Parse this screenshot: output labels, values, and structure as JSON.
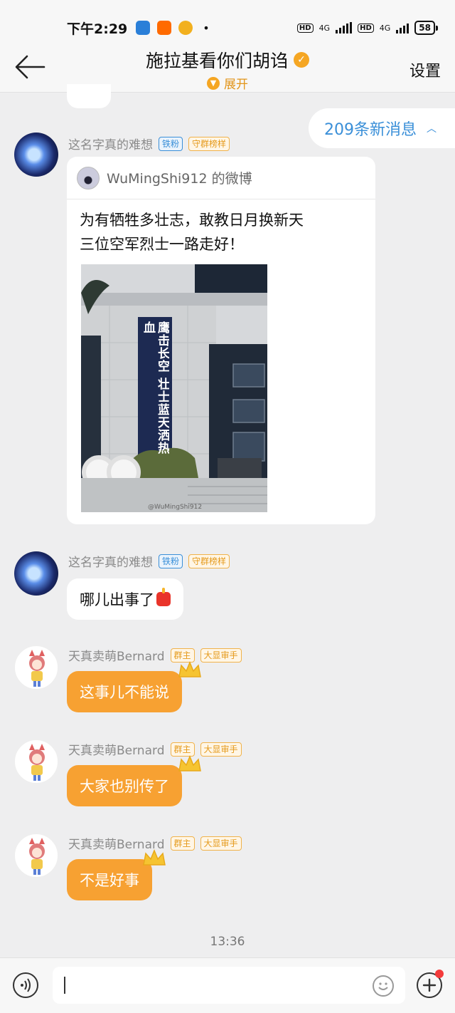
{
  "status_bar": {
    "time": "下午2:29",
    "dot": "•",
    "hd1": "HD",
    "net1": "4G",
    "hd2": "HD",
    "net2": "4G",
    "battery": "58"
  },
  "header": {
    "title": "施拉基看你们胡诌",
    "expand_label": "展开",
    "settings_label": "设置"
  },
  "new_messages": {
    "label": "209条新消息"
  },
  "messages": [
    {
      "sender": "这名字真的难想",
      "badges": [
        "铁粉",
        "守群榜样"
      ],
      "card": {
        "source": "WuMingShi912 的微博",
        "text_line1": "为有牺牲多壮志，敢教日月换新天",
        "text_line2": "三位空军烈士一路走好！",
        "banner_text": "鹰击长空 壮士蓝天洒热血",
        "watermark": "@WuMingShi912"
      }
    },
    {
      "sender": "这名字真的难想",
      "badges": [
        "铁粉",
        "守群榜样"
      ],
      "text": "哪儿出事了"
    },
    {
      "sender": "天真卖萌Bernard",
      "badges": [
        "群主",
        "大显审手"
      ],
      "text": "这事儿不能说"
    },
    {
      "sender": "天真卖萌Bernard",
      "badges": [
        "群主",
        "大显审手"
      ],
      "text": "大家也别传了"
    },
    {
      "sender": "天真卖萌Bernard",
      "badges": [
        "群主",
        "大显审手"
      ],
      "text": "不是好事"
    }
  ],
  "timestamp": "13:36",
  "input": {
    "placeholder": ""
  },
  "colors": {
    "accent_orange": "#f7a132",
    "link_blue": "#3a8fd8"
  },
  "icons": [
    "back-arrow-icon",
    "verified-icon",
    "chevron-down-icon",
    "chevron-up-icon",
    "voice-icon",
    "emoji-icon",
    "plus-icon",
    "crown-icon",
    "candle-emoji-icon"
  ]
}
